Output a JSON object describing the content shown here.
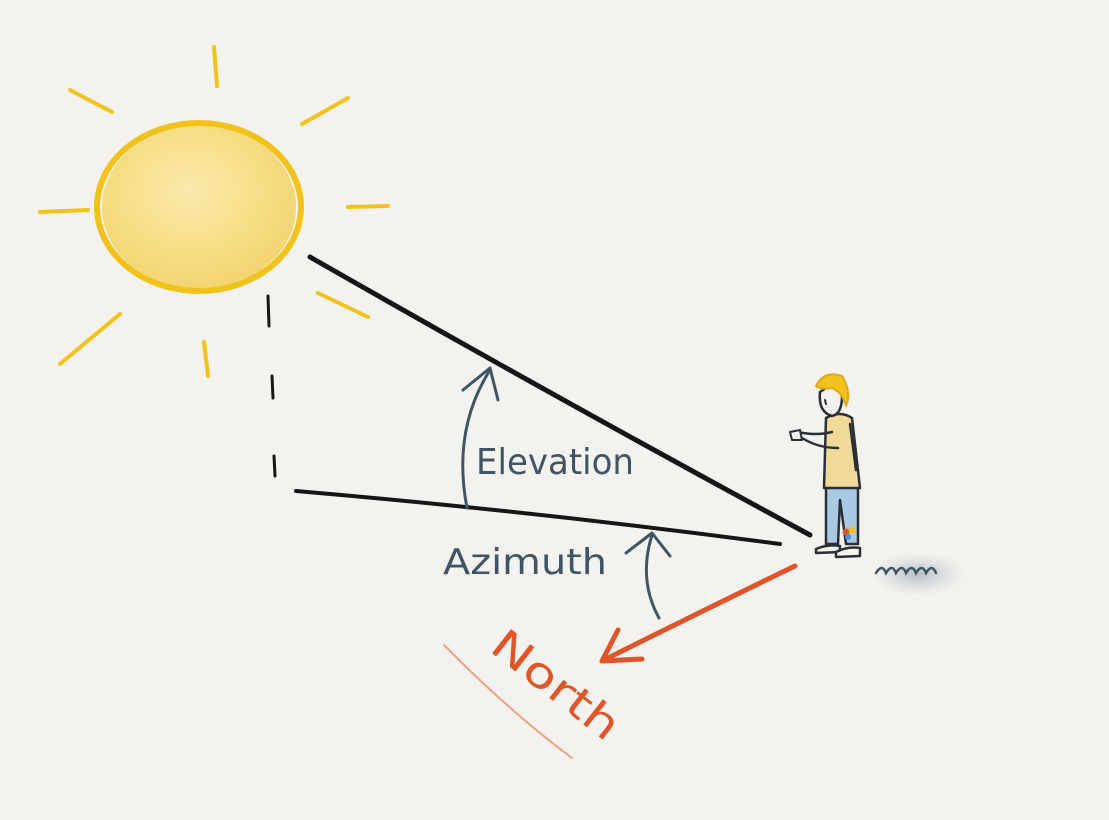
{
  "labels": {
    "elevation": "Elevation",
    "azimuth": "Azimuth",
    "north": "North"
  },
  "colors": {
    "background": "#f4f2ee",
    "sun_outline": "#f2c21c",
    "sun_fill": "#f7dc7a",
    "ray_line": "#161616",
    "angle_arrow": "#3f5566",
    "north_arrow": "#e0542a",
    "north_underline": "#eba383"
  },
  "icons": {
    "sun": "sun-icon",
    "observer": "person-icon",
    "shadow": "ground-shadow-icon"
  }
}
